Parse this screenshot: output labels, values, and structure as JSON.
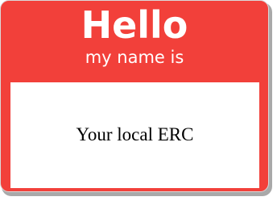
{
  "badge": {
    "greeting": "Hello",
    "subtitle": "my name is",
    "name": "Your local ERC",
    "colors": {
      "badge_red": "#f2403a",
      "text_white": "#ffffff",
      "name_text": "#000000"
    }
  }
}
